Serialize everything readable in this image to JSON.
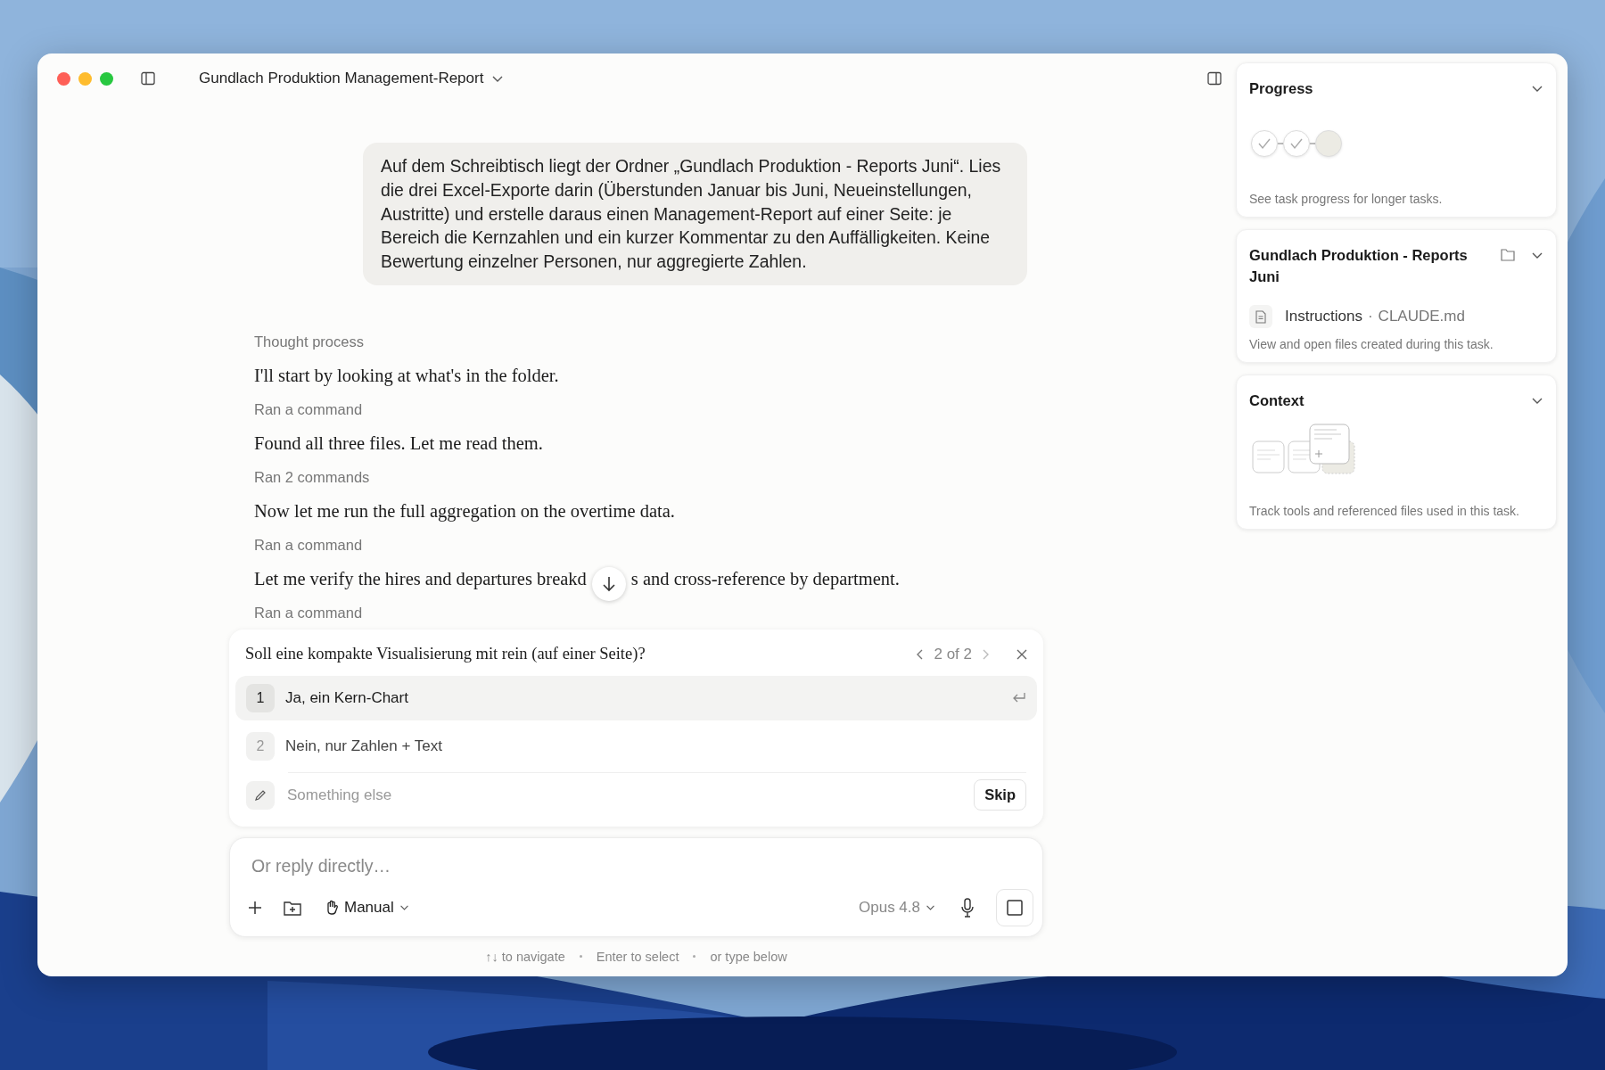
{
  "window": {
    "title": "Gundlach Produktion Management-Report"
  },
  "user_message": "Auf dem Schreibtisch liegt der Ordner „Gundlach Produktion - Reports Juni“. Lies die drei Excel-Exporte darin (Überstunden Januar bis Juni, Neueinstellungen, Austritte) und erstelle daraus einen Management-Report auf einer Seite: je Bereich die Kernzahlen und ein kurzer Kommentar zu den Auffälligkeiten. Keine Bewertung einzelner Personen, nur aggregierte Zahlen.",
  "transcript": [
    {
      "kind": "label",
      "text": "Thought process"
    },
    {
      "kind": "message",
      "text": "I'll start by looking at what's in the folder."
    },
    {
      "kind": "label",
      "text": "Ran a command"
    },
    {
      "kind": "message",
      "text": "Found all three files. Let me read them."
    },
    {
      "kind": "label",
      "text": "Ran 2 commands"
    },
    {
      "kind": "message",
      "text": "Now let me run the full aggregation on the overtime data."
    },
    {
      "kind": "label",
      "text": "Ran a command"
    },
    {
      "kind": "covered",
      "parts": [
        "Let me verify the hires and departures breakd",
        "s and cross-reference by department."
      ]
    },
    {
      "kind": "label",
      "text": "Ran a command"
    }
  ],
  "question": {
    "text": "Soll eine kompakte Visualisierung mit rein (auf einer Seite)?",
    "pager": "2 of 2",
    "options": [
      {
        "number": "1",
        "label": "Ja, ein Kern-Chart",
        "selected": true
      },
      {
        "number": "2",
        "label": "Nein, nur Zahlen + Text",
        "selected": false
      }
    ],
    "other": {
      "placeholder": "Something else"
    },
    "skip": "Skip"
  },
  "composer": {
    "placeholder": "Or reply directly…",
    "mode": "Manual",
    "model": "Opus 4.8"
  },
  "hints": [
    "↑↓ to navigate",
    "Enter to select",
    "or type below"
  ],
  "progress": {
    "title": "Progress",
    "steps": [
      {
        "done": true
      },
      {
        "done": true
      },
      {
        "done": false
      }
    ],
    "caption": "See task progress for longer tasks."
  },
  "files": {
    "title": "Gundlach Produktion - Reports Juni",
    "items": [
      {
        "name": "Instructions",
        "separator": "·",
        "file": "CLAUDE.md"
      }
    ],
    "caption": "View and open files created during this task."
  },
  "context": {
    "title": "Context",
    "caption": "Track tools and referenced files used in this task."
  }
}
